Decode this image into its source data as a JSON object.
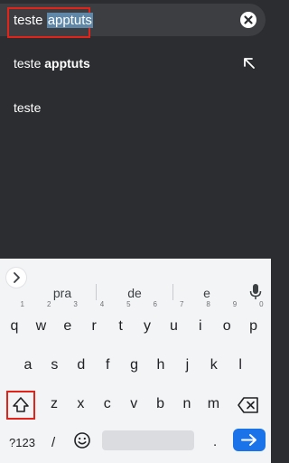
{
  "search": {
    "query_plain": "teste ",
    "query_selected": "apptuts"
  },
  "suggestions": [
    {
      "plain": "teste ",
      "bold": "apptuts",
      "has_fill_icon": true
    },
    {
      "plain": "teste",
      "bold": "",
      "has_fill_icon": false
    }
  ],
  "keyboard": {
    "suggestion_words": [
      "pra",
      "de",
      "e"
    ],
    "row1": [
      "q",
      "w",
      "e",
      "r",
      "t",
      "y",
      "u",
      "i",
      "o",
      "p"
    ],
    "row1_hints": [
      "1",
      "2",
      "3",
      "4",
      "5",
      "6",
      "7",
      "8",
      "9",
      "0"
    ],
    "row2": [
      "a",
      "s",
      "d",
      "f",
      "g",
      "h",
      "j",
      "k",
      "l"
    ],
    "row3": [
      "z",
      "x",
      "c",
      "v",
      "b",
      "n",
      "m"
    ],
    "symbols_label": "?123",
    "slash_label": "/",
    "period_label": ".",
    "accent_color": "#1a73e8"
  }
}
